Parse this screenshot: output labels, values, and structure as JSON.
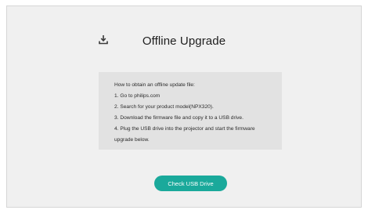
{
  "header": {
    "icon": "upgrade-download-icon",
    "title": "Offline Upgrade"
  },
  "instructions": {
    "heading": "How to obtain an offline update file:",
    "steps": [
      "1. Go to philips.com",
      "2. Search for your product model(NPX320).",
      "3. Download the firmware file and copy it to a USB drive.",
      "4. Plug the USB drive into the projector and start the firmware",
      "upgrade below."
    ]
  },
  "actions": {
    "check_usb_label": "Check USB Drive"
  },
  "colors": {
    "accent": "#1aa99b",
    "background": "#f0f0f0",
    "panel": "#e2e2e2"
  }
}
